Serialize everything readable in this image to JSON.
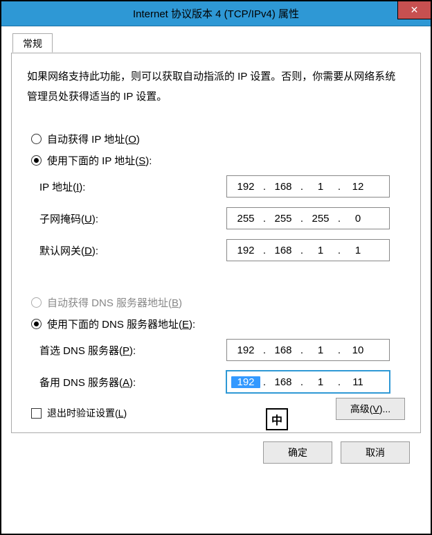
{
  "window": {
    "title": "Internet 协议版本 4 (TCP/IPv4) 属性"
  },
  "tab": {
    "general": "常规"
  },
  "description": "如果网络支持此功能，则可以获取自动指派的 IP 设置。否则，你需要从网络系统管理员处获得适当的 IP 设置。",
  "ip_section": {
    "auto_label_pre": "自动获得 IP 地址(",
    "auto_hotkey": "O",
    "auto_label_post": ")",
    "manual_label_pre": "使用下面的 IP 地址(",
    "manual_hotkey": "S",
    "manual_label_post": "):",
    "ip_label_pre": "IP 地址(",
    "ip_hotkey": "I",
    "ip_label_post": "):",
    "ip_value": [
      "192",
      "168",
      "1",
      "12"
    ],
    "mask_label_pre": "子网掩码(",
    "mask_hotkey": "U",
    "mask_label_post": "):",
    "mask_value": [
      "255",
      "255",
      "255",
      "0"
    ],
    "gw_label_pre": "默认网关(",
    "gw_hotkey": "D",
    "gw_label_post": "):",
    "gw_value": [
      "192",
      "168",
      "1",
      "1"
    ]
  },
  "dns_section": {
    "auto_label_pre": "自动获得 DNS 服务器地址(",
    "auto_hotkey": "B",
    "auto_label_post": ")",
    "manual_label_pre": "使用下面的 DNS 服务器地址(",
    "manual_hotkey": "E",
    "manual_label_post": "):",
    "pref_label_pre": "首选 DNS 服务器(",
    "pref_hotkey": "P",
    "pref_label_post": "):",
    "pref_value": [
      "192",
      "168",
      "1",
      "10"
    ],
    "alt_label_pre": "备用 DNS 服务器(",
    "alt_hotkey": "A",
    "alt_label_post": "):",
    "alt_value": [
      "192",
      "168",
      "1",
      "11"
    ]
  },
  "validate": {
    "label_pre": "退出时验证设置(",
    "hotkey": "L",
    "label_post": ")"
  },
  "buttons": {
    "advanced_pre": "高级(",
    "advanced_hotkey": "V",
    "advanced_post": ")...",
    "ok": "确定",
    "cancel": "取消"
  },
  "ime": "中"
}
